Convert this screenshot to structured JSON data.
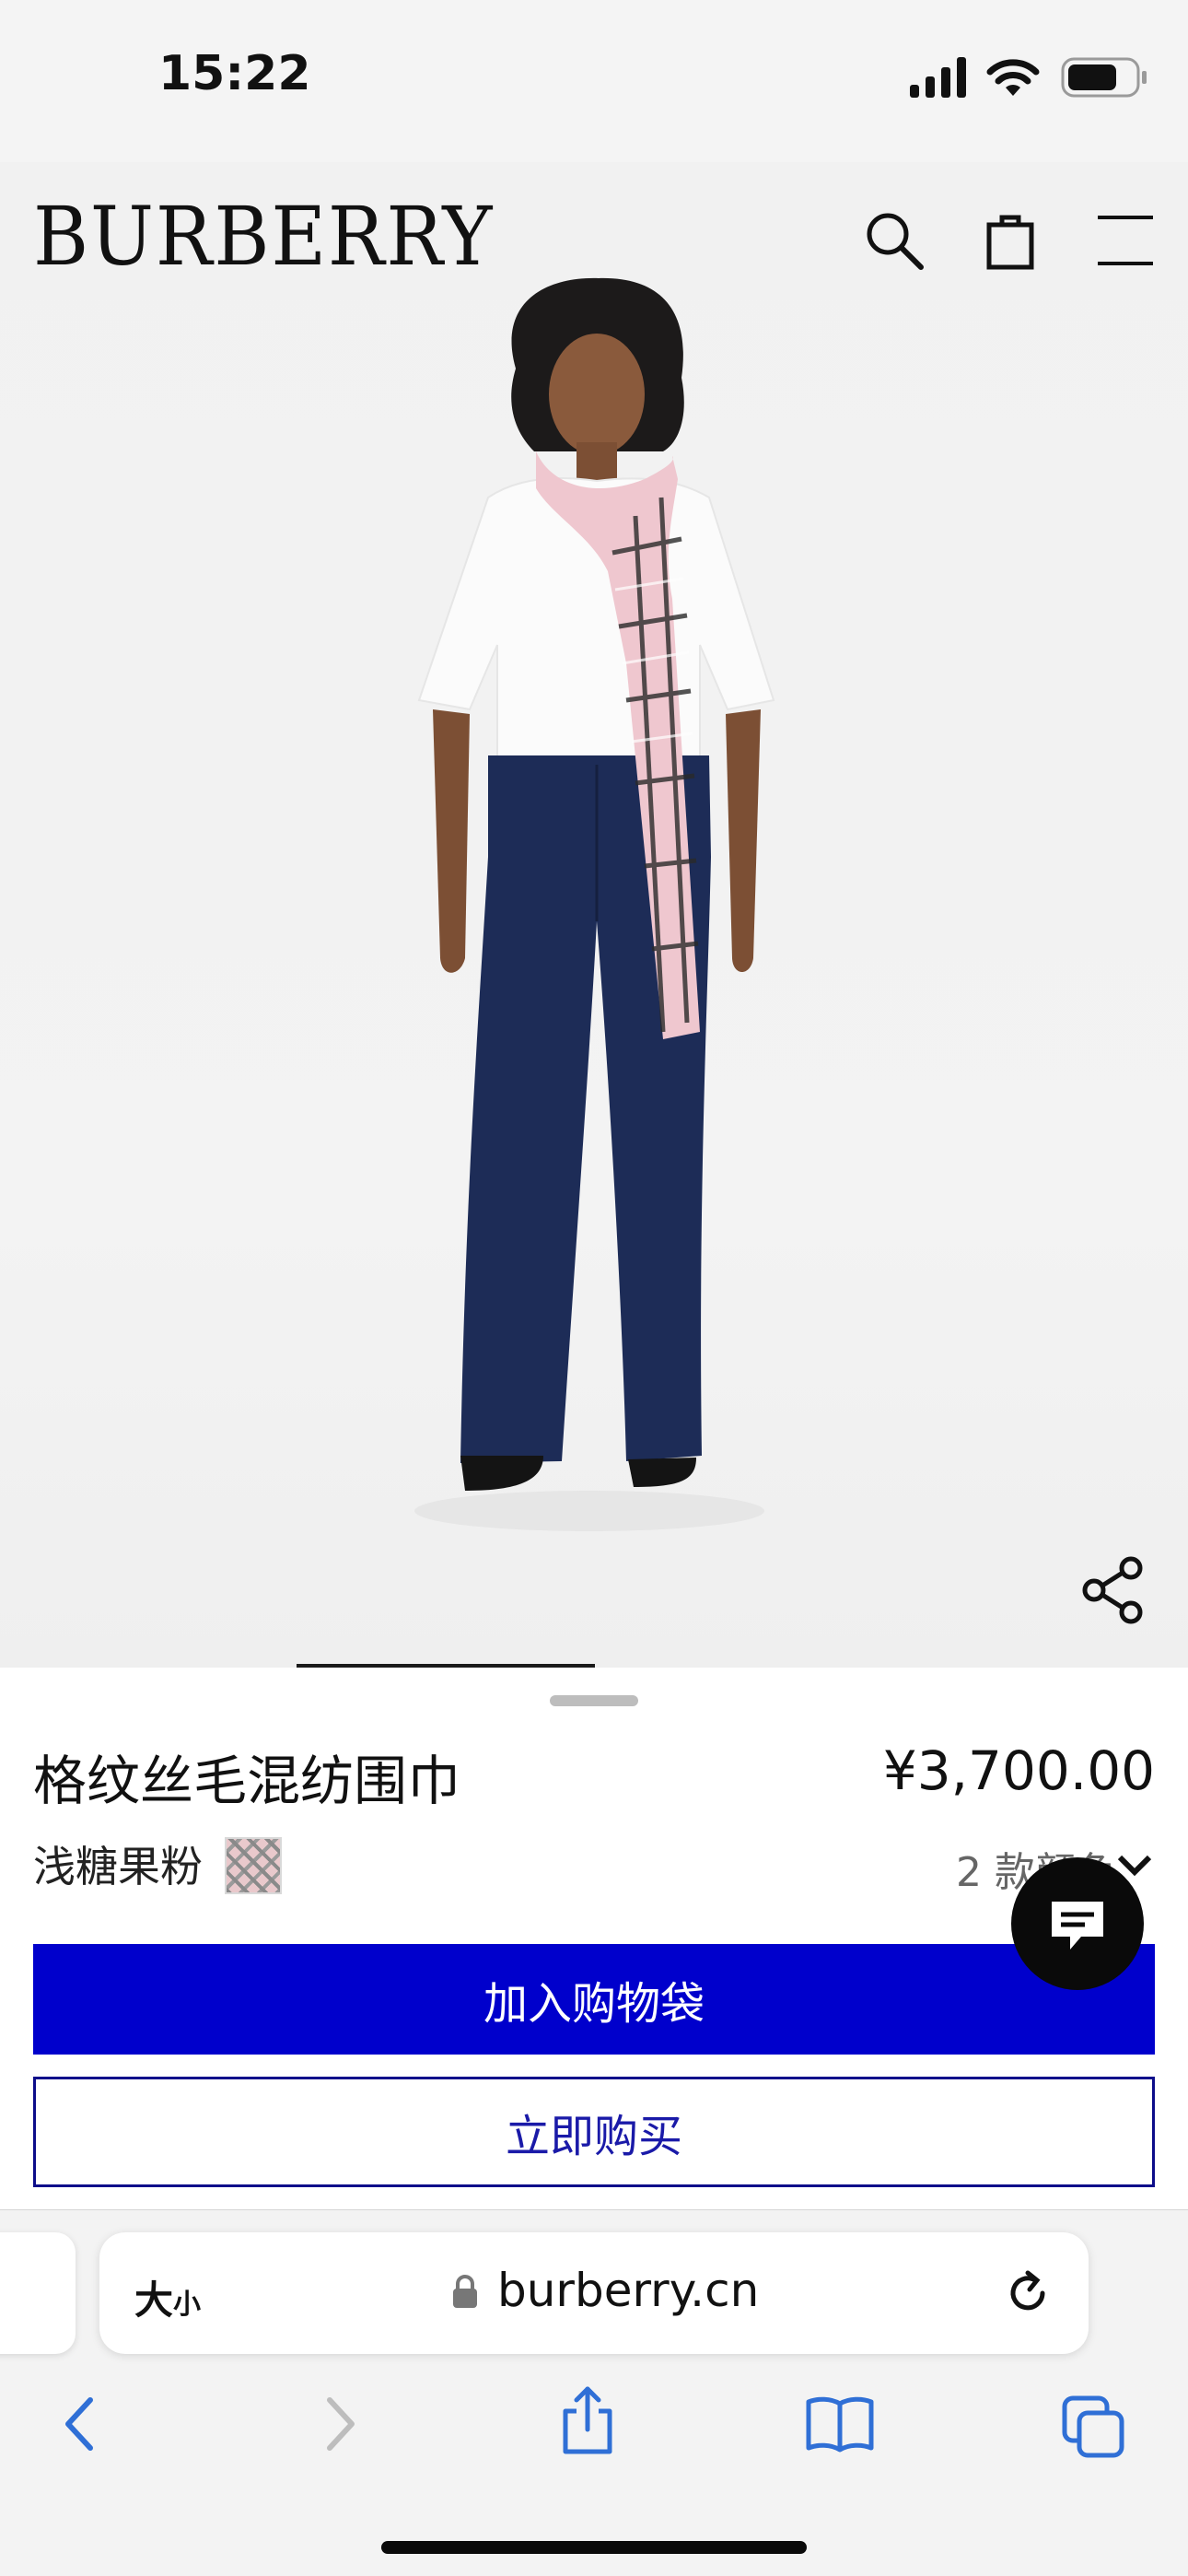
{
  "status_bar": {
    "time": "15:22",
    "icons": [
      "cellular-signal-icon",
      "wifi-icon",
      "battery-icon"
    ]
  },
  "header": {
    "brand": "BURBERRY",
    "icons": [
      "search-icon",
      "shopping-bag-icon",
      "menu-icon"
    ]
  },
  "product": {
    "name": "格纹丝毛混纺围巾",
    "price": "¥3,700.00",
    "color_name": "浅糖果粉",
    "color_count": "2 款颜色",
    "add_to_bag": "加入购物袋",
    "buy_now": "立即购买"
  },
  "browser": {
    "text_size_label": "大",
    "text_size_small": "小",
    "url": "burberry.cn",
    "toolbar_icons": [
      "back-icon",
      "forward-icon",
      "share-icon",
      "bookmarks-icon",
      "tabs-icon"
    ]
  },
  "colors": {
    "primary_button": "#0000CC",
    "outline_button": "#0D0D8A"
  }
}
